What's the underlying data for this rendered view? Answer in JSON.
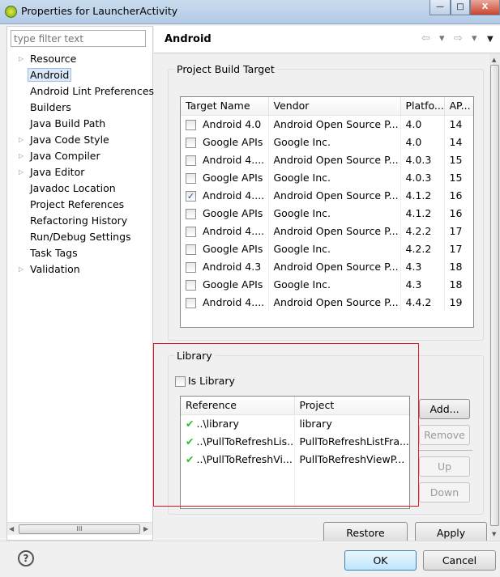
{
  "window": {
    "title": "Properties for LauncherActivity",
    "minimize": "—",
    "maximize": "□",
    "close": "X"
  },
  "sidebar": {
    "filter_placeholder": "type filter text",
    "items": [
      {
        "label": "Resource",
        "expandable": true
      },
      {
        "label": "Android",
        "selected": true
      },
      {
        "label": "Android Lint Preferences"
      },
      {
        "label": "Builders"
      },
      {
        "label": "Java Build Path"
      },
      {
        "label": "Java Code Style",
        "expandable": true
      },
      {
        "label": "Java Compiler",
        "expandable": true
      },
      {
        "label": "Java Editor",
        "expandable": true
      },
      {
        "label": "Javadoc Location"
      },
      {
        "label": "Project References"
      },
      {
        "label": "Refactoring History"
      },
      {
        "label": "Run/Debug Settings"
      },
      {
        "label": "Task Tags"
      },
      {
        "label": "Validation",
        "expandable": true
      }
    ],
    "hscroll_grip": "III"
  },
  "page": {
    "title": "Android",
    "back": "⇦",
    "forward": "⇨",
    "dropdown": "▾",
    "menu": "▼"
  },
  "build_target": {
    "label": "Project Build Target",
    "columns": [
      "Target Name",
      "Vendor",
      "Platfo...",
      "AP..."
    ],
    "rows": [
      {
        "name": "Android 4.0",
        "vendor": "Android Open Source P...",
        "platform": "4.0",
        "api": "14",
        "checked": false
      },
      {
        "name": "Google APIs",
        "vendor": "Google Inc.",
        "platform": "4.0",
        "api": "14",
        "checked": false
      },
      {
        "name": "Android 4....",
        "vendor": "Android Open Source P...",
        "platform": "4.0.3",
        "api": "15",
        "checked": false
      },
      {
        "name": "Google APIs",
        "vendor": "Google Inc.",
        "platform": "4.0.3",
        "api": "15",
        "checked": false
      },
      {
        "name": "Android 4....",
        "vendor": "Android Open Source P...",
        "platform": "4.1.2",
        "api": "16",
        "checked": true
      },
      {
        "name": "Google APIs",
        "vendor": "Google Inc.",
        "platform": "4.1.2",
        "api": "16",
        "checked": false
      },
      {
        "name": "Android 4....",
        "vendor": "Android Open Source P...",
        "platform": "4.2.2",
        "api": "17",
        "checked": false
      },
      {
        "name": "Google APIs",
        "vendor": "Google Inc.",
        "platform": "4.2.2",
        "api": "17",
        "checked": false
      },
      {
        "name": "Android 4.3",
        "vendor": "Android Open Source P...",
        "platform": "4.3",
        "api": "18",
        "checked": false
      },
      {
        "name": "Google APIs",
        "vendor": "Google Inc.",
        "platform": "4.3",
        "api": "18",
        "checked": false
      },
      {
        "name": "Android 4....",
        "vendor": "Android Open Source P...",
        "platform": "4.4.2",
        "api": "19",
        "checked": false
      }
    ]
  },
  "library": {
    "label": "Library",
    "is_library_label": "Is Library",
    "is_library": false,
    "columns": [
      "Reference",
      "Project"
    ],
    "rows": [
      {
        "reference": "..\\library",
        "project": "library"
      },
      {
        "reference": "..\\PullToRefreshLis...",
        "project": "PullToRefreshListFra..."
      },
      {
        "reference": "..\\PullToRefreshVi...",
        "project": "PullToRefreshViewP..."
      }
    ],
    "buttons": {
      "add": "Add...",
      "remove": "Remove",
      "up": "Up",
      "down": "Down"
    }
  },
  "page_buttons": {
    "restore": "Restore Defaults",
    "apply": "Apply"
  },
  "dialog": {
    "help": "?",
    "ok": "OK",
    "cancel": "Cancel"
  },
  "colors": {
    "highlight": "#e81123",
    "check": "#2fbf2f"
  }
}
